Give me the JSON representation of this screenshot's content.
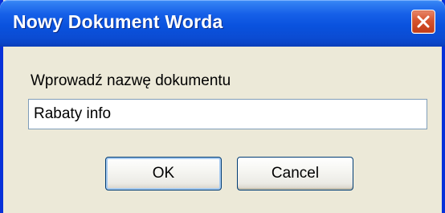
{
  "window": {
    "title": "Nowy Dokument Worda",
    "close_icon": "close-icon"
  },
  "dialog": {
    "prompt_label": "Wprowadź nazwę dokumentu",
    "name_value": "Rabaty info",
    "ok_label": "OK",
    "cancel_label": "Cancel"
  },
  "colors": {
    "titlebar": "#0a52de",
    "frame": "#0831d9",
    "dialog_background": "#ece9d8",
    "close_button": "#d6542e"
  }
}
